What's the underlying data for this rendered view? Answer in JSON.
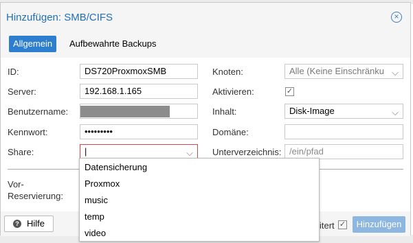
{
  "dialog": {
    "title": "Hinzufügen: SMB/CIFS",
    "close_icon": "close-circle-icon"
  },
  "tabs": [
    {
      "label": "Allgemein",
      "active": true
    },
    {
      "label": "Aufbewahrte Backups",
      "active": false
    }
  ],
  "form": {
    "id": {
      "label": "ID:",
      "value": "DS720ProxmoxSMB"
    },
    "server": {
      "label": "Server:",
      "value": "192.168.1.165"
    },
    "username": {
      "label": "Benutzername:",
      "value": ""
    },
    "password": {
      "label": "Kennwort:",
      "value": "•••••••••"
    },
    "share": {
      "label": "Share:",
      "value": "|"
    },
    "reservation": {
      "label_line1": "Vor-",
      "label_line2": "Reservierung:"
    },
    "nodes": {
      "label": "Knoten:",
      "value": "Alle (Keine Einschränku"
    },
    "enable": {
      "label": "Aktivieren:",
      "checked": true,
      "check_glyph": "✓"
    },
    "content": {
      "label": "Inhalt:",
      "value": "Disk-Image"
    },
    "domain": {
      "label": "Domäne:",
      "value": ""
    },
    "subdirectory": {
      "label": "Unterverzeichnis:",
      "placeholder": "/ein/pfad"
    }
  },
  "share_options": [
    "Datensicherung",
    "Proxmox",
    "music",
    "temp",
    "video"
  ],
  "footer": {
    "help_label": "Hilfe",
    "help_glyph": "?",
    "partial_text": "itert",
    "partial_check_glyph": "✓",
    "add_label": "Hinzufügen"
  },
  "glyphs": {
    "chevron": "⌵",
    "close": "×"
  },
  "colors": {
    "accent": "#2e7ecf",
    "title": "#1f6fb8",
    "add_button": "#8db6e0",
    "invalid_border": "#c94a4a"
  }
}
